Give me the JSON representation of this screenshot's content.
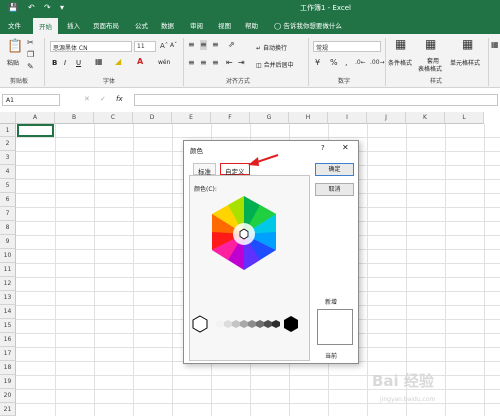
{
  "window": {
    "title": "工作簿1 - Excel"
  },
  "tabs": [
    "文件",
    "开始",
    "插入",
    "页面布局",
    "公式",
    "数据",
    "审阅",
    "视图",
    "帮助"
  ],
  "active_tab": "开始",
  "tell_me": "告诉我你想要做什么",
  "ribbon": {
    "paste_label": "粘贴",
    "font_name": "思源黑体 CN",
    "font_size": "11",
    "bold": "B",
    "italic": "I",
    "underline": "U",
    "wen": "wén",
    "wrap_text": "自动换行",
    "merge_center": "合并后居中",
    "number_format": "常规",
    "cond_format": "条件格式",
    "table_format_1": "套用",
    "table_format_2": "表格格式",
    "cell_styles": "单元格样式",
    "groups": {
      "clipboard": "剪贴板",
      "font": "字体",
      "alignment": "对齐方式",
      "number": "数字",
      "styles": "样式"
    }
  },
  "formula_bar": {
    "name_box": "A1",
    "fx": "fx"
  },
  "columns": [
    "A",
    "B",
    "C",
    "D",
    "E",
    "F",
    "G",
    "H",
    "I",
    "J",
    "K",
    "L"
  ],
  "rows": [
    "1",
    "2",
    "3",
    "4",
    "5",
    "6",
    "7",
    "8",
    "9",
    "10",
    "11",
    "12",
    "13",
    "14",
    "15",
    "16",
    "17",
    "18",
    "19",
    "20",
    "21"
  ],
  "dialog": {
    "title": "颜色",
    "help": "?",
    "close": "✕",
    "tab_standard": "标准",
    "tab_custom": "自定义",
    "colors_label": "颜色(C):",
    "ok": "确定",
    "cancel": "取消",
    "new_label": "新增",
    "current_label": "当前"
  },
  "accent_color": "#217346",
  "highlight_color": "#e02020",
  "watermark": {
    "text": "Bai 经验",
    "sub": "jingyan.baidu.com"
  }
}
